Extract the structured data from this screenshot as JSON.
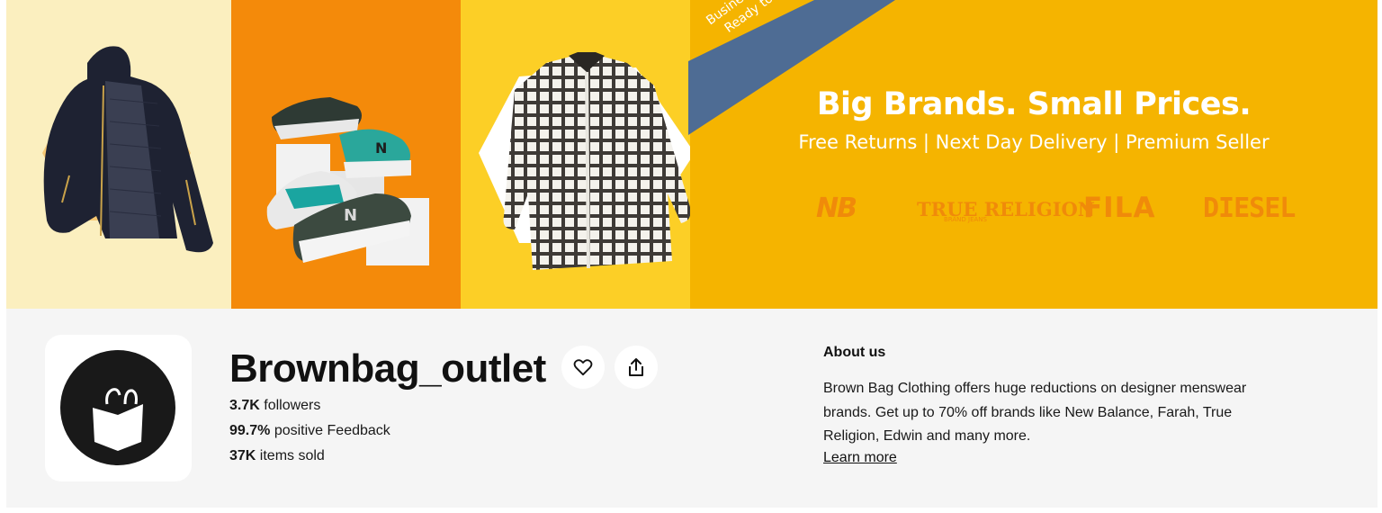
{
  "banner": {
    "ribbon_line1": "Business as usual",
    "ribbon_line2": "Ready to ship!",
    "headline": "Big Brands. Small Prices.",
    "subline": "Free Returns | Next Day Delivery | Premium Seller",
    "brands": {
      "new_balance": "NB",
      "true_religion": "TRUE RELIGION",
      "true_religion_sub": "BRAND JEANS",
      "fila": "FILA",
      "diesel": "DIESEL"
    },
    "colors": {
      "panel1": "#fbefbf",
      "panel2": "#f48a0a",
      "panel3": "#fccf26",
      "panel4": "#f5b400",
      "ribbon": "#4e6c94"
    }
  },
  "store": {
    "name": "Brownbag_outlet",
    "logo_icon": "shopping-bag-icon",
    "followers_value": "3.7K",
    "followers_label": " followers",
    "feedback_value": "99.7%",
    "feedback_label": " positive Feedback",
    "sold_value": "37K",
    "sold_label": " items sold",
    "favorite_icon": "heart-icon",
    "share_icon": "share-icon"
  },
  "about": {
    "title": "About us",
    "text": "Brown Bag Clothing offers huge reductions on designer menswear brands. Get up to 70% off brands like New Balance, Farah, True Religion, Edwin and many more.",
    "learn_more": "Learn more"
  }
}
